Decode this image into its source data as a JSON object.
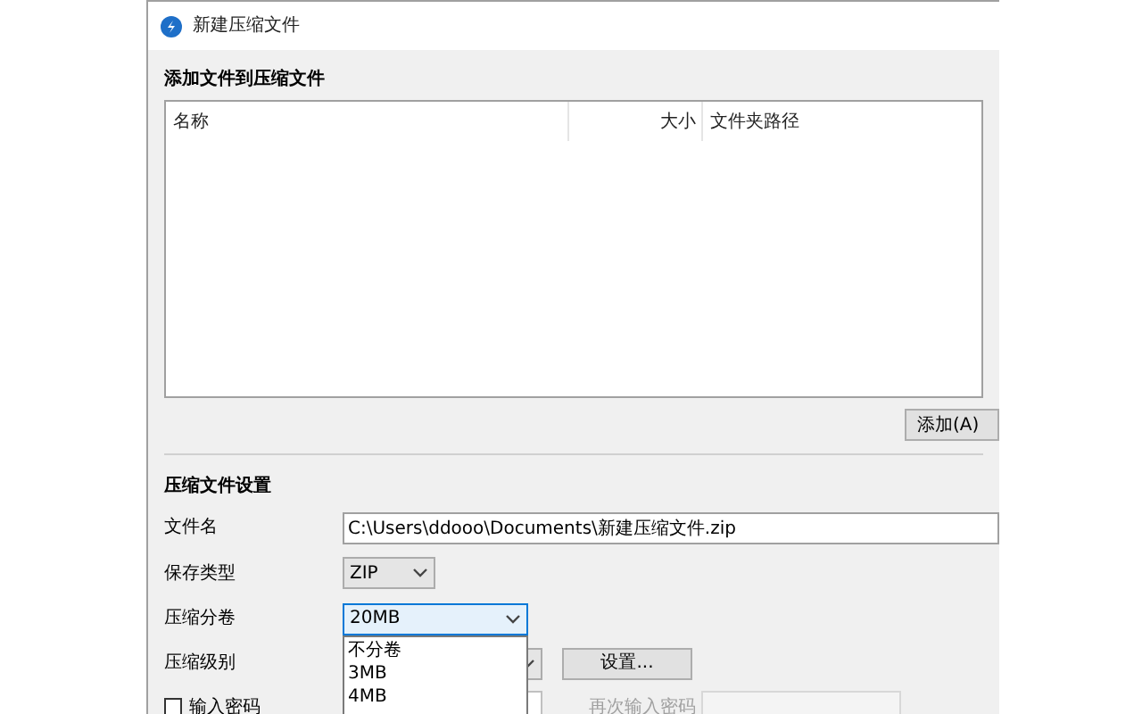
{
  "window": {
    "title": "新建压缩文件"
  },
  "add_section": {
    "title": "添加文件到压缩文件",
    "columns": [
      "名称",
      "大小",
      "文件夹路径"
    ],
    "add_button": "添加(A)"
  },
  "settings": {
    "title": "压缩文件设置",
    "filename": {
      "label": "文件名",
      "value": "C:\\Users\\ddooo\\Documents\\新建压缩文件.zip"
    },
    "save_type": {
      "label": "保存类型",
      "value": "ZIP"
    },
    "split": {
      "label": "压缩分卷",
      "value": "20MB",
      "expanded": true,
      "options": [
        "不分卷",
        "3MB",
        "4MB"
      ]
    },
    "level": {
      "label": "压缩级别",
      "settings_button": "设置..."
    },
    "password": {
      "label": "输入密码",
      "checked": false,
      "confirm_label": "再次输入密码"
    }
  }
}
